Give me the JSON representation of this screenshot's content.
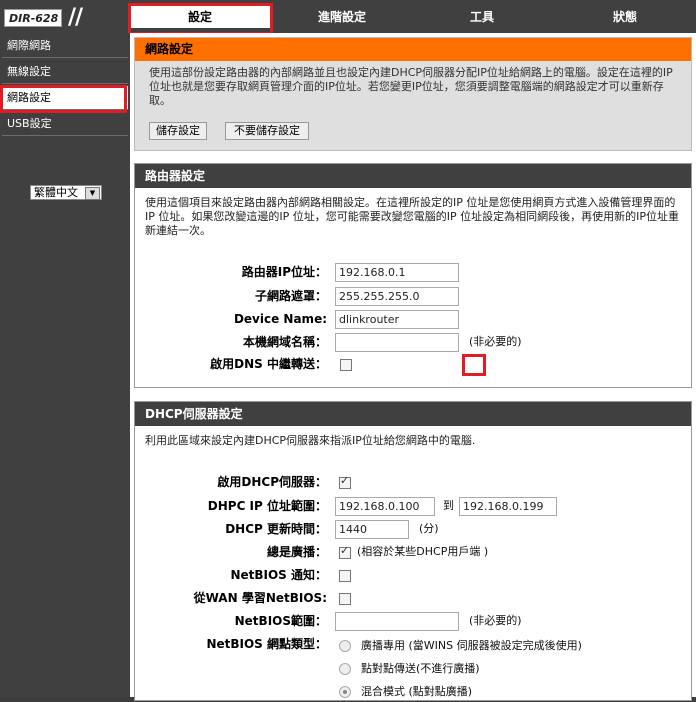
{
  "header": {
    "model": "DIR-628",
    "tabs": [
      {
        "label": "設定"
      },
      {
        "label": "進階設定"
      },
      {
        "label": "工具"
      },
      {
        "label": "狀態"
      }
    ]
  },
  "sidebar": {
    "items": [
      {
        "label": "網際網路"
      },
      {
        "label": "無線設定"
      },
      {
        "label": "網路設定"
      },
      {
        "label": "USB設定"
      }
    ],
    "language": "繁體中文"
  },
  "network_settings": {
    "title": "網路設定",
    "description": "使用這部份設定路由器的內部網路並且也設定內建DHCP伺服器分配IP位址給網路上的電腦。設定在這裡的IP位址也就是您要存取網頁管理介面的IP位址。若您變更IP位址，您須要調整電腦端的網路設定才可以重新存取。",
    "save_label": "儲存設定",
    "dont_save_label": "不要儲存設定"
  },
  "router_settings": {
    "title": "路由器設定",
    "description": "使用這個項目來設定路由器內部網路相關設定。在這裡所設定的IP 位址是您使用網頁方式進入設備管理界面的IP 位址。如果您改變這邊的IP 位址，您可能需要改變您電腦的IP 位址設定為相同網段後，再使用新的IP位址重新連結一次。",
    "ip_label": "路由器IP位址：",
    "ip_value": "192.168.0.1",
    "mask_label": "子網路遮罩：",
    "mask_value": "255.255.255.0",
    "device_label": "Device Name:",
    "device_value": "dlinkrouter",
    "domain_label": "本機網域名稱：",
    "domain_value": "",
    "optional": "(非必要的)",
    "dns_relay_label": "啟用DNS 中繼轉送：",
    "dns_relay_checked": false
  },
  "dhcp_settings": {
    "title": "DHCP伺服器設定",
    "description": "利用此區域來設定內建DHCP伺服器來指派IP位址給您網路中的電腦.",
    "enable_label": "啟用DHCP伺服器：",
    "enable_checked": true,
    "range_label": "DHPC IP 位址範圍：",
    "range_start": "192.168.0.100",
    "range_to": "到",
    "range_end": "192.168.0.199",
    "lease_label": "DHCP 更新時間：",
    "lease_value": "1440",
    "lease_unit": "(分)",
    "broadcast_label": "總是廣播：",
    "broadcast_checked": true,
    "broadcast_note": "(相容於某些DHCP用戶端 )",
    "netbios_announce_label": "NetBIOS 通知：",
    "netbios_announce_checked": false,
    "netbios_wan_label": "從WAN 學習NetBIOS:",
    "netbios_wan_checked": false,
    "netbios_scope_label": "NetBIOS範圍：",
    "netbios_scope_value": "",
    "netbios_scope_optional": "(非必要的)",
    "node_type_label": "NetBIOS 網點類型：",
    "node_options": [
      {
        "label": "廣播專用 (當WINS 伺服器被設定完成後使用)",
        "selected": false
      },
      {
        "label": "點對點傳送(不進行廣播)",
        "selected": false
      },
      {
        "label": "混合模式 (點對點廣播)",
        "selected": true
      }
    ]
  },
  "colors": {
    "accent_orange": "#ff6f00",
    "highlight_red": "#e31b23",
    "dark_bar": "#404040"
  }
}
